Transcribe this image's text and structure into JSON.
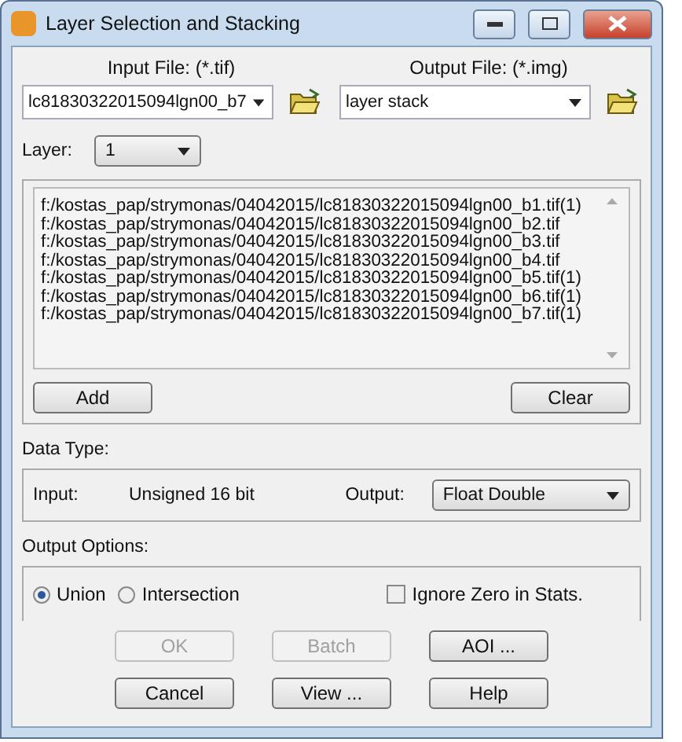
{
  "window": {
    "title": "Layer Selection and Stacking"
  },
  "input_file": {
    "label": "Input File: (*.tif)",
    "value": "lc81830322015094lgn00_b7"
  },
  "output_file": {
    "label": "Output File: (*.img)",
    "value": "layer stack"
  },
  "layer": {
    "label": "Layer:",
    "value": "1"
  },
  "file_list": [
    "f:/kostas_pap/strymonas/04042015/lc81830322015094lgn00_b1.tif(1)",
    "f:/kostas_pap/strymonas/04042015/lc81830322015094lgn00_b2.tif",
    "f:/kostas_pap/strymonas/04042015/lc81830322015094lgn00_b3.tif",
    "f:/kostas_pap/strymonas/04042015/lc81830322015094lgn00_b4.tif",
    "f:/kostas_pap/strymonas/04042015/lc81830322015094lgn00_b5.tif(1)",
    "f:/kostas_pap/strymonas/04042015/lc81830322015094lgn00_b6.tif(1)",
    "f:/kostas_pap/strymonas/04042015/lc81830322015094lgn00_b7.tif(1)"
  ],
  "list_buttons": [
    {
      "label": "Add"
    },
    {
      "label": "Clear"
    }
  ],
  "data_type": {
    "heading": "Data Type:",
    "input_label": "Input:",
    "input_value": "Unsigned 16 bit",
    "output_label": "Output:",
    "output_value": "Float Double"
  },
  "output_options": {
    "heading": "Output Options:",
    "modes": [
      {
        "label": "Union",
        "selected": true
      },
      {
        "label": "Intersection",
        "selected": false
      }
    ],
    "ignore_zero": {
      "label": "Ignore Zero in Stats.",
      "checked": false
    }
  },
  "buttons": [
    {
      "label": "OK",
      "disabled": true
    },
    {
      "label": "Batch",
      "disabled": true
    },
    {
      "label": "AOI ...",
      "disabled": false
    },
    {
      "label": "Cancel",
      "disabled": false
    },
    {
      "label": "View ...",
      "disabled": false
    },
    {
      "label": "Help",
      "disabled": false
    }
  ]
}
